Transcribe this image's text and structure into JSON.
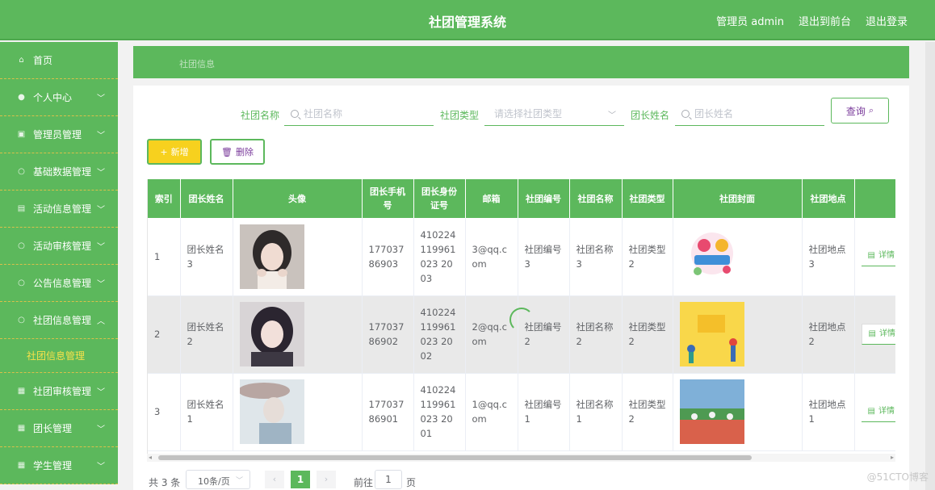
{
  "header": {
    "title": "社团管理系统",
    "user": "管理员 admin",
    "front_link": "退出到前台",
    "logout": "退出登录"
  },
  "sidebar": {
    "items": [
      {
        "label": "首页",
        "icon": "home-icon"
      },
      {
        "label": "个人中心",
        "icon": "user-icon"
      },
      {
        "label": "管理员管理",
        "icon": "admin-icon"
      },
      {
        "label": "基础数据管理",
        "icon": "data-icon"
      },
      {
        "label": "活动信息管理",
        "icon": "activity-icon"
      },
      {
        "label": "活动审核管理",
        "icon": "audit-icon"
      },
      {
        "label": "公告信息管理",
        "icon": "notice-icon"
      },
      {
        "label": "社团信息管理",
        "icon": "club-icon"
      },
      {
        "label": "社团审核管理",
        "icon": "review-icon"
      },
      {
        "label": "团长管理",
        "icon": "leader-icon"
      },
      {
        "label": "学生管理",
        "icon": "student-icon"
      }
    ],
    "active_sub": "社团信息管理"
  },
  "breadcrumb": "社团信息",
  "search": {
    "club_name_label": "社团名称",
    "club_name_placeholder": "社团名称",
    "club_type_label": "社团类型",
    "club_type_placeholder": "请选择社团类型",
    "leader_name_label": "团长姓名",
    "leader_name_placeholder": "团长姓名",
    "query_label": "查询"
  },
  "actions": {
    "add_label": "新增",
    "delete_label": "删除"
  },
  "table": {
    "headers": [
      "索引",
      "团长姓名",
      "头像",
      "团长手机号",
      "团长身份证号",
      "邮箱",
      "社团编号",
      "社团名称",
      "社团类型",
      "社团封面",
      "社团地点",
      ""
    ],
    "rows": [
      {
        "index": "1",
        "leader": "团长姓名3",
        "phone": "17703786903",
        "idcard": "410224119961023 2003",
        "email": "3@qq.com",
        "club_no": "社团编号3",
        "club_name": "社团名称3",
        "club_type": "社团类型2",
        "place": "社团地点3",
        "action": "详情"
      },
      {
        "index": "2",
        "leader": "团长姓名2",
        "phone": "17703786902",
        "idcard": "410224119961023 2002",
        "email": "2@qq.com",
        "club_no": "社团编号2",
        "club_name": "社团名称2",
        "club_type": "社团类型2",
        "place": "社团地点2",
        "action": "详情"
      },
      {
        "index": "3",
        "leader": "团长姓名1",
        "phone": "17703786901",
        "idcard": "410224119961023 2001",
        "email": "1@qq.com",
        "club_no": "社团编号1",
        "club_name": "社团名称1",
        "club_type": "社团类型2",
        "place": "社团地点1",
        "action": "详情"
      }
    ]
  },
  "pagination": {
    "total": "共 3 条",
    "page_size": "10条/页",
    "current": "1",
    "goto_label": "前往",
    "goto_value": "1",
    "page_unit": "页"
  },
  "watermark": "@51CTO博客",
  "colors": {
    "primary": "#5cb85c",
    "accent": "#f7d11e",
    "text_purple": "#7a3b9b"
  }
}
